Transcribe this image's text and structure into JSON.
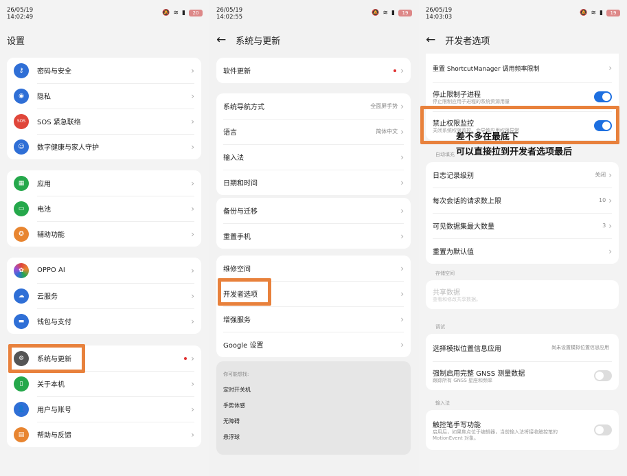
{
  "p1": {
    "time": "26/05/19",
    "time2": "14:02:49",
    "battery": "20",
    "title": "设置",
    "g1": [
      "密码与安全",
      "隐私",
      "SOS 紧急联络",
      "数字健康与家人守护"
    ],
    "g2": [
      "应用",
      "电池",
      "辅助功能"
    ],
    "g3": [
      "OPPO AI",
      "云服务",
      "钱包与支付"
    ],
    "g4": [
      "系统与更新",
      "关于本机",
      "用户与账号",
      "帮助与反馈"
    ],
    "sos_icon": "SOS"
  },
  "p2": {
    "time": "26/05/19",
    "time2": "14:02:55",
    "battery": "19",
    "title": "系统与更新",
    "g1": [
      "软件更新"
    ],
    "g2": [
      {
        "label": "系统导航方式",
        "value": "全面屏手势"
      },
      {
        "label": "语言",
        "value": "简体中文"
      },
      {
        "label": "输入法",
        "value": ""
      },
      {
        "label": "日期和时间",
        "value": ""
      }
    ],
    "g3": [
      "备份与迁移",
      "重置手机"
    ],
    "g4": [
      "维修空间",
      "开发者选项",
      "增强服务",
      "Google 设置"
    ],
    "g5_title": "你可能想找:",
    "g5": [
      "定时开关机",
      "手势体感",
      "无障碍",
      "悬浮球"
    ]
  },
  "p3": {
    "time": "26/05/19",
    "time2": "14:03:03",
    "battery": "19",
    "title": "开发者选项",
    "r_reset": "重置 ShortcutManager 调用频率限制",
    "r_stop": "停止限制子进程",
    "r_stop_sub": "停止限制应用子进程的系统资源用量",
    "r_ban": "禁止权限监控",
    "r_ban_sub": "关闭系统权限监控、会导致应用权限异常",
    "sect_auto": "自动填充",
    "g2": [
      {
        "label": "日志记录级别",
        "value": "关闭"
      },
      {
        "label": "每次会话的请求数上限",
        "value": "10"
      },
      {
        "label": "可见数据集最大数量",
        "value": "3"
      },
      {
        "label": "重置为默认值",
        "value": ""
      }
    ],
    "sect_storage": "存储空间",
    "shared": "共享数据",
    "shared_sub": "查看和修改共享数据。",
    "sect_debug": "调试",
    "mock": "选择模拟位置信息应用",
    "mock_val": "尚未设置模拟位置信息应用",
    "gnss": "强制启用完整 GNSS 测量数据",
    "gnss_sub": "跟踪所有 GNSS 星座和频率",
    "sect_input": "输入法",
    "stylus": "触控笔手写功能",
    "stylus_sub": "启用后，如果焦点位于编辑器，当前输入法将接收触控笔的 MotionEvent 对象。"
  },
  "annotation": {
    "line1": "差不多在最底下",
    "line2": "可以直接拉到开发者选项最后"
  },
  "colors": {
    "highlight": "#e8813c",
    "toggle_on": "#1d6fe0",
    "blue_icon": "#2f6fd6",
    "green_icon": "#25a84b",
    "orange_icon": "#e88530",
    "red_icon": "#e0463a"
  }
}
